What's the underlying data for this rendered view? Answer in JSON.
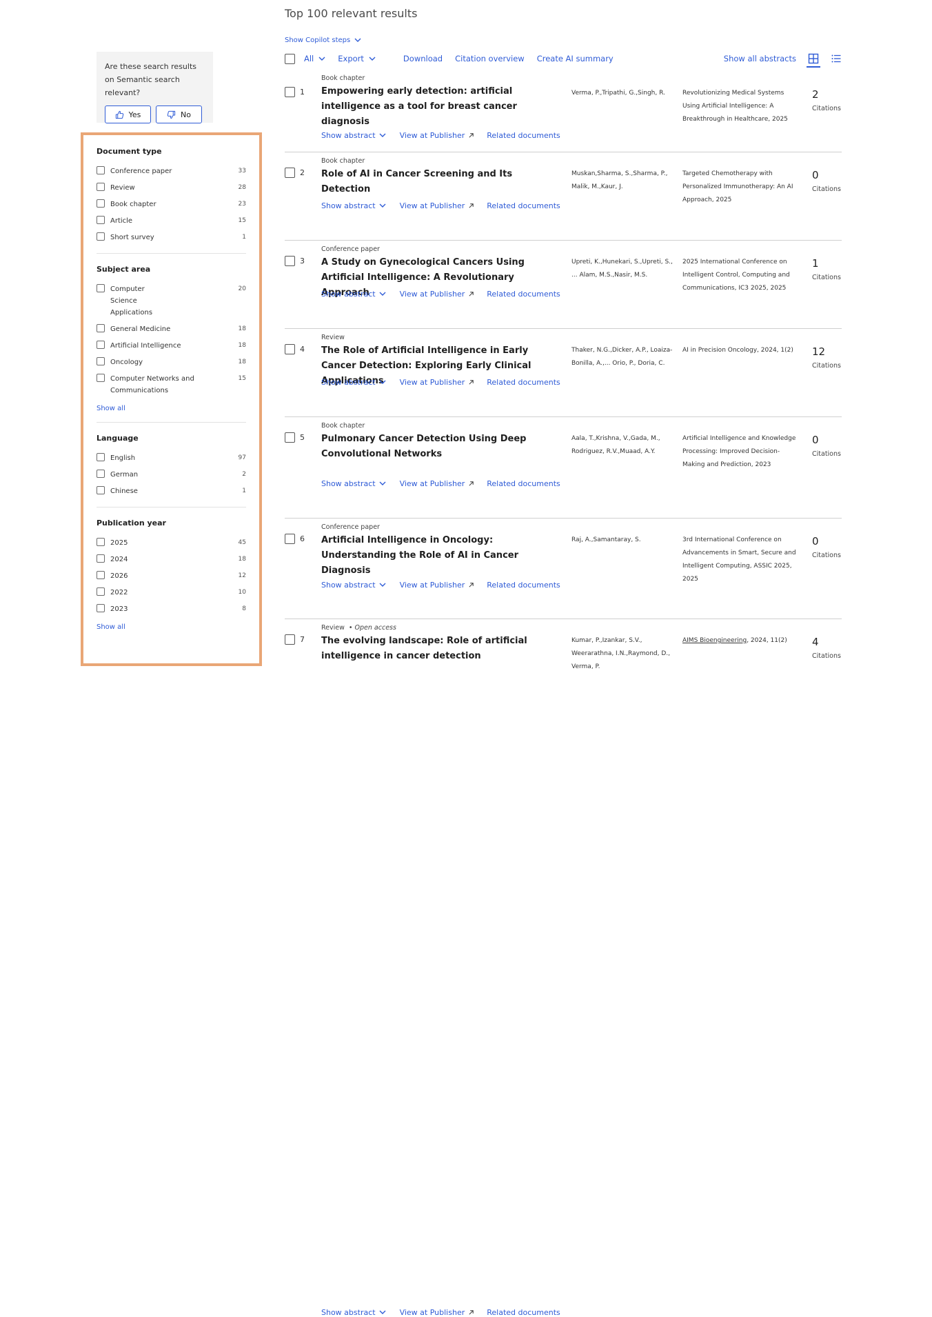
{
  "header": {
    "title": "Top 100 relevant results",
    "copilot_steps": "Show Copilot steps"
  },
  "toolbar": {
    "all": "All",
    "export": "Export",
    "download": "Download",
    "citation_overview": "Citation overview",
    "create_ai_summary": "Create AI summary",
    "show_all_abstracts": "Show all abstracts"
  },
  "feedback": {
    "question": "Are these search results on Semantic search relevant?",
    "yes": "Yes",
    "no": "No"
  },
  "filters": {
    "document_type": {
      "title": "Document type",
      "items": [
        {
          "label": "Conference paper",
          "count": "33"
        },
        {
          "label": "Review",
          "count": "28"
        },
        {
          "label": "Book chapter",
          "count": "23"
        },
        {
          "label": "Article",
          "count": "15"
        },
        {
          "label": "Short survey",
          "count": "1"
        }
      ]
    },
    "subject_area": {
      "title": "Subject area",
      "items": [
        {
          "label": "Computer Science Applications",
          "count": "20"
        },
        {
          "label": "General Medicine",
          "count": "18"
        },
        {
          "label": "Artificial Intelligence",
          "count": "18"
        },
        {
          "label": "Oncology",
          "count": "18"
        },
        {
          "label": "Computer Networks and Communications",
          "count": "15"
        }
      ],
      "show_all": "Show all"
    },
    "language": {
      "title": "Language",
      "items": [
        {
          "label": "English",
          "count": "97"
        },
        {
          "label": "German",
          "count": "2"
        },
        {
          "label": "Chinese",
          "count": "1"
        }
      ]
    },
    "publication_year": {
      "title": "Publication year",
      "items": [
        {
          "label": "2025",
          "count": "45"
        },
        {
          "label": "2024",
          "count": "18"
        },
        {
          "label": "2026",
          "count": "12"
        },
        {
          "label": "2022",
          "count": "10"
        },
        {
          "label": "2023",
          "count": "8"
        }
      ],
      "show_all": "Show all"
    }
  },
  "result_links": {
    "show_abstract": "Show abstract",
    "view_at_publisher": "View at Publisher",
    "related_documents": "Related documents",
    "citations_label": "Citations"
  },
  "results": [
    {
      "num": "1",
      "type": "Book chapter",
      "open_access": "",
      "title": "Empowering early detection: artificial intelligence as a tool for breast cancer diagnosis",
      "authors": "Verma, P.,Tripathi, G.,Singh, R.",
      "source": "Revolutionizing Medical Systems Using Artificial Intelligence: A Breakthrough in Healthcare, 2025",
      "source_link": "",
      "citations": "2"
    },
    {
      "num": "2",
      "type": "Book chapter",
      "open_access": "",
      "title": "Role of AI in Cancer Screening and Its Detection",
      "authors": "Muskan,Sharma, S.,Sharma, P., Malik, M.,Kaur, J.",
      "source": "Targeted Chemotherapy with Personalized Immunotherapy: An AI Approach, 2025",
      "source_link": "",
      "citations": "0"
    },
    {
      "num": "3",
      "type": "Conference paper",
      "open_access": "",
      "title": "A Study on Gynecological Cancers Using Artificial Intelligence: A Revolutionary Approach",
      "authors": "Upreti, K.,Hunekari, S.,Upreti, S., ... Alam, M.S.,Nasir, M.S.",
      "source": "2025 International Conference on Intelligent Control, Computing and Communications, IC3 2025, 2025",
      "source_link": "",
      "citations": "1"
    },
    {
      "num": "4",
      "type": "Review",
      "open_access": "",
      "title": "The Role of Artificial Intelligence in Early Cancer Detection: Exploring Early Clinical Applications",
      "authors": "Thaker, N.G.,Dicker, A.P., Loaiza-Bonilla, A.,... Orio, P., Doria, C.",
      "source": "AI in Precision Oncology, 2024, 1(2)",
      "source_link": "",
      "citations": "12"
    },
    {
      "num": "5",
      "type": "Book chapter",
      "open_access": "",
      "title": "Pulmonary Cancer Detection Using Deep Convolutional Networks",
      "authors": "Aala, T.,Krishna, V.,Gada, M., Rodriguez, R.V.,Muaad, A.Y.",
      "source": "Artificial Intelligence and Knowledge Processing: Improved Decision-Making and Prediction, 2023",
      "source_link": "",
      "citations": "0"
    },
    {
      "num": "6",
      "type": "Conference paper",
      "open_access": "",
      "title": "Artificial Intelligence in Oncology: Understanding the Role of AI in Cancer Diagnosis",
      "authors": "Raj, A.,Samantaray, S.",
      "source": "3rd International Conference on Advancements in Smart, Secure and Intelligent Computing, ASSIC 2025, 2025",
      "source_link": "",
      "citations": "0"
    },
    {
      "num": "7",
      "type": "Review",
      "open_access": "Open access",
      "title": "The evolving landscape: Role of artificial intelligence in cancer detection",
      "authors": "Kumar, P.,Izankar, S.V., Weerarathna, I.N.,Raymond, D., Verma, P.",
      "source": ", 2024, 11(2)",
      "source_link": "AIMS Bioengineering",
      "citations": "4"
    }
  ],
  "colors": {
    "link": "#2e5bd6",
    "filter_highlight_border": "#e9a676",
    "feedback_bg": "#f3f3f3"
  },
  "icons": [
    "chevron-down-icon",
    "external-link-icon",
    "thumbs-up-icon",
    "thumbs-down-icon",
    "grid-view-icon",
    "list-view-icon"
  ]
}
